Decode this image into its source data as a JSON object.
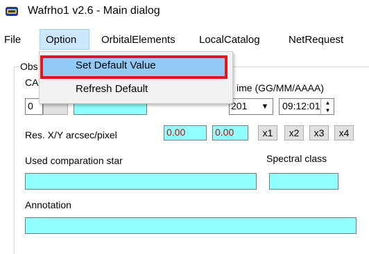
{
  "window": {
    "title": "Wafrho1 v2.6 - Main dialog",
    "icon": "app-logo-icon"
  },
  "menubar": {
    "items": [
      "File",
      "Option",
      "OrbitalElements",
      "LocalCatalog",
      "NetRequest"
    ]
  },
  "option_menu": {
    "items": [
      "Set Default Value",
      "Refresh Default"
    ]
  },
  "group": {
    "label": "Obs"
  },
  "fields": {
    "ca_label": "CA",
    "left_combo_value": "0",
    "time_label": "ime (GG/MM/AAAA)",
    "date_combo_value": "201",
    "time_value": "09:12:01",
    "res_label": "Res. X/Y arcsec/pixel",
    "res_x": "0.00",
    "res_y": "0.00",
    "zoom_buttons": [
      "x1",
      "x2",
      "x3",
      "x4"
    ],
    "used_star_label": "Used comparation star",
    "spectral_label": "Spectral class",
    "annotation_label": "Annotation"
  },
  "colors": {
    "field_bg": "#90ffff",
    "value_text": "#cc0000",
    "menu_highlight": "#91c9f7",
    "red_outline": "#e8141c"
  }
}
